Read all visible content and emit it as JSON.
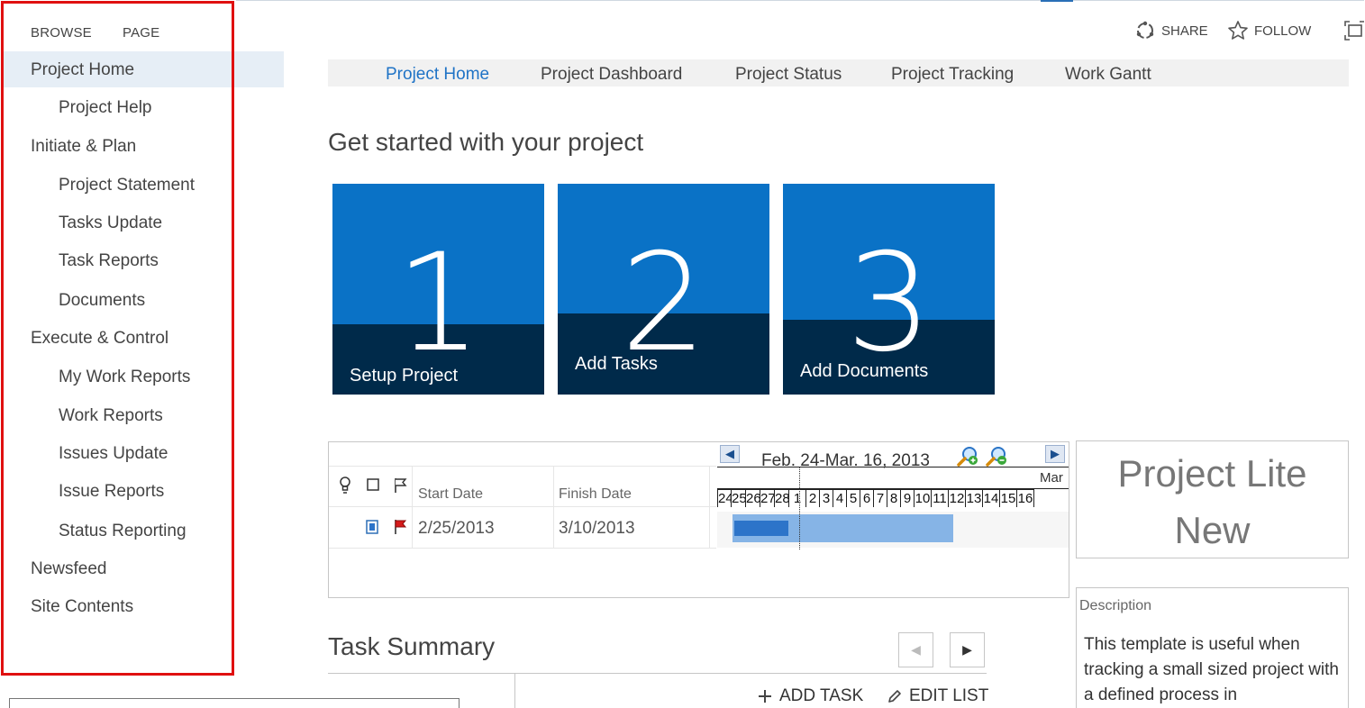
{
  "ribbon": {
    "tabs": [
      "BROWSE",
      "PAGE"
    ],
    "share_label": "SHARE",
    "follow_label": "FOLLOW"
  },
  "sidebar": {
    "items": [
      {
        "label": "Project Home",
        "level": 1,
        "selected": true
      },
      {
        "label": "Project Help",
        "level": 2
      },
      {
        "label": "Initiate & Plan",
        "level": 1
      },
      {
        "label": "Project Statement",
        "level": 2
      },
      {
        "label": "Tasks Update",
        "level": 2
      },
      {
        "label": "Task Reports",
        "level": 2
      },
      {
        "label": "Documents",
        "level": 2
      },
      {
        "label": "Execute & Control",
        "level": 1
      },
      {
        "label": "My Work Reports",
        "level": 2
      },
      {
        "label": "Work Reports",
        "level": 2
      },
      {
        "label": "Issues Update",
        "level": 2
      },
      {
        "label": "Issue Reports",
        "level": 2
      },
      {
        "label": "Status Reporting",
        "level": 2
      },
      {
        "label": "Newsfeed",
        "level": 1
      },
      {
        "label": "Site Contents",
        "level": 1
      }
    ]
  },
  "topnav": {
    "items": [
      "Project Home",
      "Project Dashboard",
      "Project Status",
      "Project Tracking",
      "Work Gantt"
    ],
    "active": "Project Home"
  },
  "main": {
    "heading": "Get started with your project",
    "tiles": [
      {
        "number": "1",
        "label": "Setup Project"
      },
      {
        "number": "2",
        "label": "Add Tasks"
      },
      {
        "number": "3",
        "label": "Add Documents"
      }
    ]
  },
  "gantt": {
    "columns": {
      "start": "Start Date",
      "finish": "Finish Date"
    },
    "rows": [
      {
        "start": "2/25/2013",
        "finish": "3/10/2013"
      }
    ],
    "range_label": "Feb. 24-Mar. 16, 2013",
    "month_label": "Mar",
    "days": [
      "24",
      "25",
      "26",
      "27",
      "28",
      "1",
      "2",
      "3",
      "4",
      "5",
      "6",
      "7",
      "8",
      "9",
      "10",
      "11",
      "12",
      "13",
      "14",
      "15",
      "16"
    ]
  },
  "template_panel": {
    "title_line1": "Project Lite",
    "title_line2": "New",
    "description_label": "Description",
    "description_text": "This template is useful when tracking a small sized project with a defined process in"
  },
  "task_summary": {
    "heading": "Task Summary",
    "add_task_label": "ADD TASK",
    "edit_list_label": "EDIT LIST"
  },
  "colors": {
    "accent": "#1f73c6",
    "tile": "#0a72c6",
    "tile_band": "#002a4a",
    "annotation": "#e01010"
  }
}
